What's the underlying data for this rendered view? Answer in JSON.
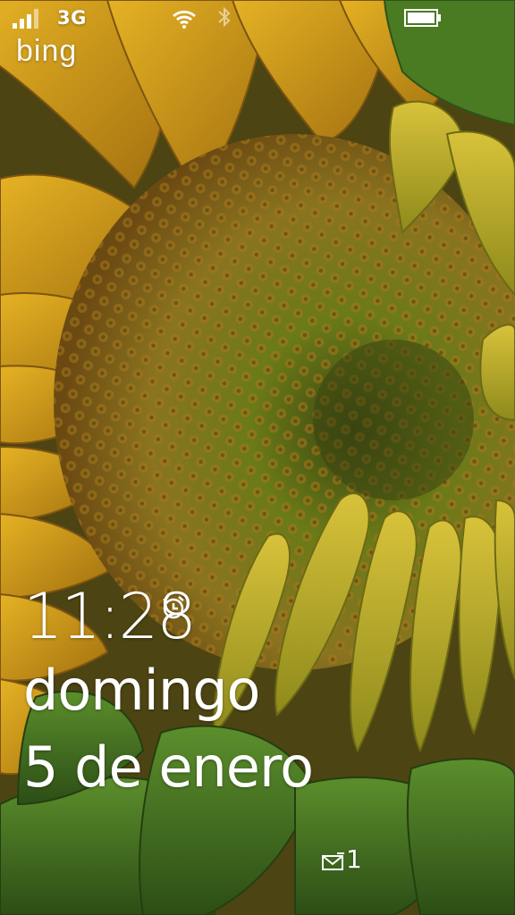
{
  "status_bar": {
    "network_type": "3G",
    "icons": [
      "signal-bars-icon",
      "wifi-icon",
      "bluetooth-icon",
      "battery-icon"
    ]
  },
  "brand": {
    "logo_text": "bing"
  },
  "lock_screen": {
    "time": "11:28",
    "day": "domingo",
    "date": "5 de enero",
    "alarm_icon": "alarm-clock-icon"
  },
  "notifications": {
    "mail_icon": "mail-icon",
    "mail_count": "1"
  },
  "colors": {
    "text": "#ffffff",
    "petal": "#d9a317",
    "seed_center": "#4f5a12",
    "leaf": "#4a7a22"
  }
}
